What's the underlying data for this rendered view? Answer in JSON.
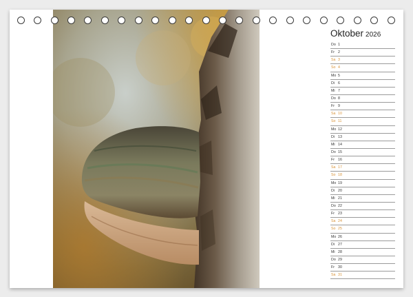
{
  "calendar": {
    "month": "Oktober",
    "year": "2026",
    "weekend_color": "#d9943a",
    "days": [
      {
        "name": "Do",
        "num": "1",
        "weekend": false
      },
      {
        "name": "Fr",
        "num": "2",
        "weekend": false
      },
      {
        "name": "Sa",
        "num": "3",
        "weekend": true
      },
      {
        "name": "So",
        "num": "4",
        "weekend": true
      },
      {
        "name": "Mo",
        "num": "5",
        "weekend": false
      },
      {
        "name": "Di",
        "num": "6",
        "weekend": false
      },
      {
        "name": "Mi",
        "num": "7",
        "weekend": false
      },
      {
        "name": "Do",
        "num": "8",
        "weekend": false
      },
      {
        "name": "Fr",
        "num": "9",
        "weekend": false
      },
      {
        "name": "Sa",
        "num": "10",
        "weekend": true
      },
      {
        "name": "So",
        "num": "11",
        "weekend": true
      },
      {
        "name": "Mo",
        "num": "12",
        "weekend": false
      },
      {
        "name": "Di",
        "num": "13",
        "weekend": false
      },
      {
        "name": "Mi",
        "num": "14",
        "weekend": false
      },
      {
        "name": "Do",
        "num": "15",
        "weekend": false
      },
      {
        "name": "Fr",
        "num": "16",
        "weekend": false
      },
      {
        "name": "Sa",
        "num": "17",
        "weekend": true
      },
      {
        "name": "So",
        "num": "18",
        "weekend": true
      },
      {
        "name": "Mo",
        "num": "19",
        "weekend": false
      },
      {
        "name": "Di",
        "num": "20",
        "weekend": false
      },
      {
        "name": "Mi",
        "num": "21",
        "weekend": false
      },
      {
        "name": "Do",
        "num": "22",
        "weekend": false
      },
      {
        "name": "Fr",
        "num": "23",
        "weekend": false
      },
      {
        "name": "Sa",
        "num": "24",
        "weekend": true
      },
      {
        "name": "So",
        "num": "25",
        "weekend": true
      },
      {
        "name": "Mo",
        "num": "26",
        "weekend": false
      },
      {
        "name": "Di",
        "num": "27",
        "weekend": false
      },
      {
        "name": "Mi",
        "num": "28",
        "weekend": false
      },
      {
        "name": "Do",
        "num": "29",
        "weekend": false
      },
      {
        "name": "Fr",
        "num": "30",
        "weekend": false
      },
      {
        "name": "Sa",
        "num": "31",
        "weekend": true
      }
    ]
  },
  "photo": {
    "subject": "tree-fungus-photo"
  }
}
